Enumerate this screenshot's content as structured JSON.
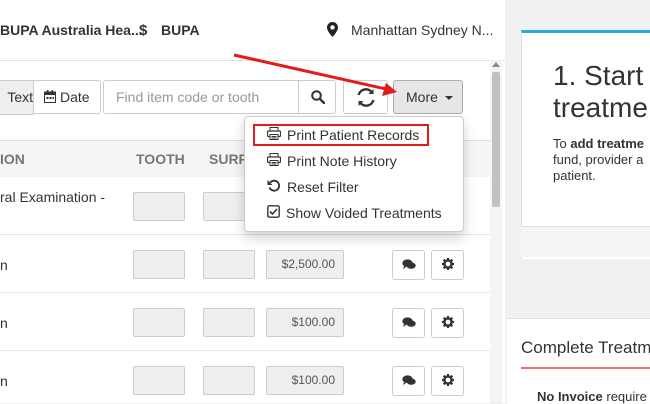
{
  "topbar": {
    "insurer": "BUPA Australia Hea...",
    "currency_icon": "$",
    "fund": "BUPA",
    "location": "Manhattan Sydney N..."
  },
  "toolbar": {
    "text_label": "Text",
    "date_label": "Date",
    "search_placeholder": "Find item code or tooth",
    "more_label": "More"
  },
  "table": {
    "headers": [
      "ION",
      "TOOTH",
      "SURF"
    ],
    "rows": [
      {
        "desc_line1": "ral Examination -",
        "fee": ""
      },
      {
        "desc_line1": "n",
        "fee": "$2,500.00"
      },
      {
        "desc_line1": "n",
        "fee": "$100.00"
      },
      {
        "desc_line1": "n",
        "fee": "$100.00"
      }
    ]
  },
  "dropdown": {
    "items": [
      {
        "label": "Print Patient Records",
        "icon": "print-icon"
      },
      {
        "label": "Print Note History",
        "icon": "print-icon"
      },
      {
        "label": "Reset Filter",
        "icon": "undo-icon"
      },
      {
        "label": "Show Voided Treatments",
        "icon": "checkbox-icon"
      }
    ]
  },
  "right_panel": {
    "heading_line1": "1. Start",
    "heading_line2": "treatme",
    "body_prefix": "To ",
    "body_bold": "add treatme",
    "body_line2": "fund, provider a",
    "body_line3": "patient.",
    "card2_title": "Complete Treatm",
    "card2_bold": "No Invoice",
    "card2_rest": " require"
  },
  "colors": {
    "accent_blue": "#29a9e0",
    "annotation_red": "#e31b1b"
  }
}
